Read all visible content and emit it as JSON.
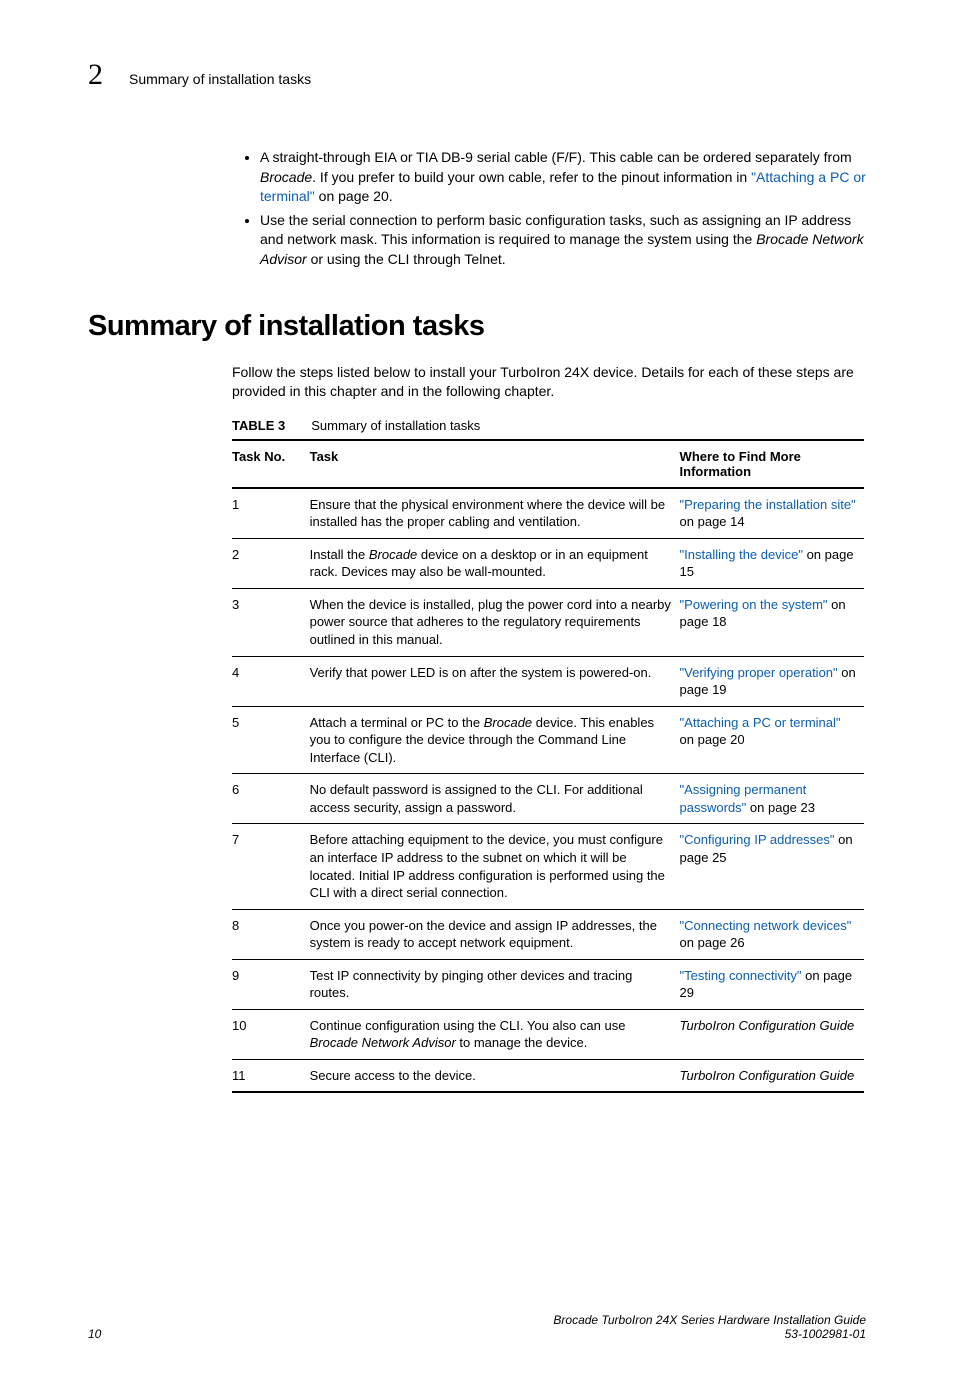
{
  "header": {
    "chapter": "2",
    "title": "Summary of installation tasks"
  },
  "bullets": {
    "b1a": "A straight-through EIA or TIA DB-9 serial cable (F/F). This cable can be ordered separately from ",
    "b1_italic": "Brocade",
    "b1b": ". If you prefer to build your own cable, refer to the pinout information in ",
    "b1_link": "\"Attaching a PC or terminal\"",
    "b1_tail": " on page 20.",
    "b2a": "Use the serial connection to perform basic configuration tasks, such as assigning an IP address and network mask. This information is required to manage the system using the ",
    "b2_italic": "Brocade Network Advisor",
    "b2b": " or using the CLI through Telnet."
  },
  "h1": "Summary of installation tasks",
  "intro": "Follow the steps listed below to install your TurboIron 24X device. Details for each of these steps are provided in this chapter and in the following chapter.",
  "table": {
    "label": "TABLE 3",
    "caption": "Summary of installation tasks",
    "col1": "Task No.",
    "col2": "Task",
    "col3": "Where to Find More Information"
  },
  "rows": {
    "r1n": "1",
    "r1t": "Ensure that the physical environment where the device will be installed has the proper cabling and ventilation.",
    "r1l": "\"Preparing the installation site\"",
    "r1p": " on page 14",
    "r2n": "2",
    "r2t_a": "Install the ",
    "r2t_i": "Brocade",
    "r2t_b": " device on a desktop or in an equipment rack. Devices may also be wall-mounted.",
    "r2l": "\"Installing the device\"",
    "r2p": " on page 15",
    "r3n": "3",
    "r3t": "When the device is installed, plug the power cord into a nearby power source that adheres to the regulatory requirements outlined in this manual.",
    "r3l": "\"Powering on the system\"",
    "r3p": " on page 18",
    "r4n": "4",
    "r4t": "Verify that power LED is on after the system is powered-on.",
    "r4l": "\"Verifying proper operation\"",
    "r4p": " on page 19",
    "r5n": "5",
    "r5t_a": "Attach a terminal or PC to the ",
    "r5t_i": "Brocade",
    "r5t_b": " device. This enables you to configure the device through the Command Line Interface (CLI).",
    "r5l": "\"Attaching a PC or terminal\"",
    "r5p": " on page 20",
    "r6n": "6",
    "r6t": "No default password is assigned to the CLI. For additional access security, assign a password.",
    "r6l": "\"Assigning permanent passwords\"",
    "r6p": " on page 23",
    "r7n": "7",
    "r7t": "Before attaching equipment to the device, you must configure an interface IP address to the subnet on which it will be located. Initial IP address configuration is performed using the CLI with a direct serial connection.",
    "r7l": "\"Configuring IP addresses\"",
    "r7p": " on page 25",
    "r8n": "8",
    "r8t": "Once you power-on the device and assign IP addresses, the system is ready to accept network equipment.",
    "r8l": "\"Connecting network devices\"",
    "r8p": " on page 26",
    "r9n": "9",
    "r9t": "Test IP connectivity by pinging other devices and tracing routes.",
    "r9l": "\"Testing connectivity\"",
    "r9p": " on page 29",
    "r10n": "10",
    "r10t_a": "Continue configuration using the CLI. You also can use ",
    "r10t_i": "Brocade Network Advisor",
    "r10t_b": " to manage the device.",
    "r10w": "TurboIron Configuration Guide",
    "r11n": "11",
    "r11t": "Secure access to the device.",
    "r11w": "TurboIron Configuration Guide"
  },
  "footer": {
    "page": "10",
    "guide": "Brocade TurboIron 24X Series Hardware Installation Guide",
    "docno": "53-1002981-01"
  }
}
